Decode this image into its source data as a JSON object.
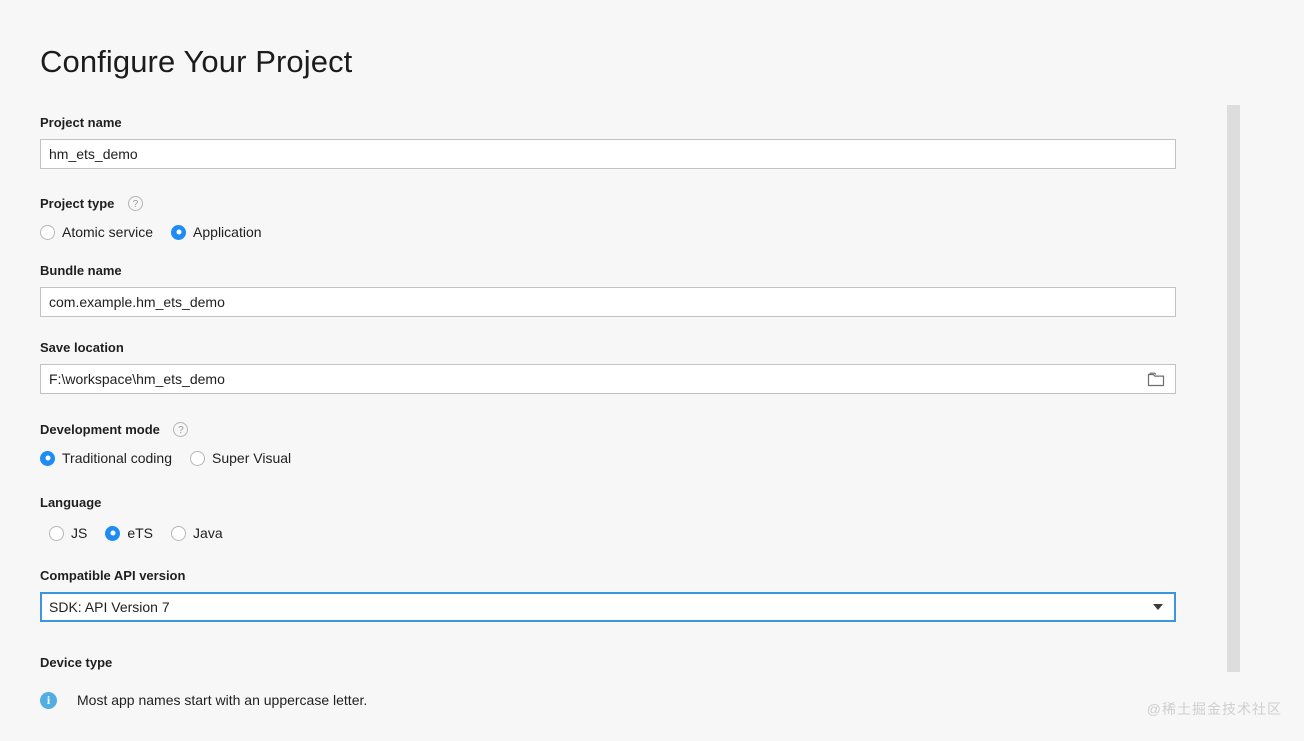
{
  "window": {
    "title": "Configure Your Project"
  },
  "fields": {
    "project_name": {
      "label": "Project name",
      "value": "hm_ets_demo",
      "placeholder": "Project name"
    },
    "project_type": {
      "label": "Project type",
      "help_icon": "help-circle-icon",
      "options": [
        {
          "label": "Atomic service",
          "selected": false
        },
        {
          "label": "Application",
          "selected": true
        }
      ]
    },
    "bundle_name": {
      "label": "Bundle name",
      "value": "com.example.hm_ets_demo",
      "placeholder": "Bundle name"
    },
    "save_location": {
      "label": "Save location",
      "value": "F:\\workspace\\hm_ets_demo",
      "placeholder": "Save location",
      "browse_icon": "folder-icon"
    },
    "development_mode": {
      "label": "Development mode",
      "help_icon": "help-circle-icon",
      "options": [
        {
          "label": "Traditional coding",
          "selected": true
        },
        {
          "label": "Super Visual",
          "selected": false
        }
      ]
    },
    "language": {
      "label": "Language",
      "options": [
        {
          "label": "JS",
          "selected": false
        },
        {
          "label": "eTS",
          "selected": true
        },
        {
          "label": "Java",
          "selected": false
        }
      ]
    },
    "compatible_api_version": {
      "label": "Compatible API version",
      "value": "SDK: API Version 7",
      "caret_icon": "chevron-down-icon",
      "focused": true
    },
    "device_type": {
      "label": "Device type"
    }
  },
  "footer": {
    "icon": "info-circle-icon",
    "message": "Most app names start with an uppercase letter."
  },
  "watermark": {
    "text": "@稀土掘金技术社区"
  },
  "colors": {
    "accent": "#1f8cf5",
    "focus_border": "#3a96dd",
    "info": "#52aee0",
    "background": "#f7f7f7"
  }
}
